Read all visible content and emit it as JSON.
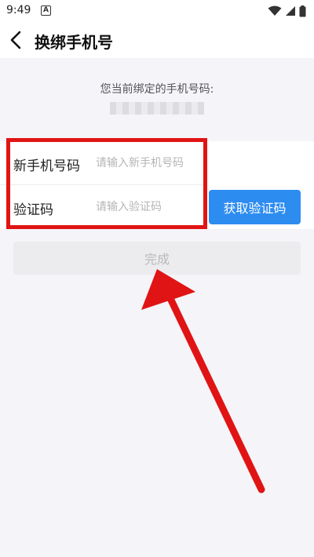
{
  "status_bar": {
    "time": "9:49",
    "notification_letter": "A",
    "icons": [
      "wifi-icon",
      "signal-icon",
      "battery-icon"
    ]
  },
  "header": {
    "title": "换绑手机号",
    "back_icon": "chevron-left-icon"
  },
  "current": {
    "label": "您当前绑定的手机号码:"
  },
  "form": {
    "phone_label": "新手机号码",
    "phone_placeholder": "请输入新手机号码",
    "phone_value": "",
    "code_label": "验证码",
    "code_placeholder": "请输入验证码",
    "code_value": "",
    "get_code_label": "获取验证码"
  },
  "done_label": "完成",
  "colors": {
    "accent": "#2d8cf0",
    "highlight": "#e01414",
    "background": "#f4f4f9"
  }
}
